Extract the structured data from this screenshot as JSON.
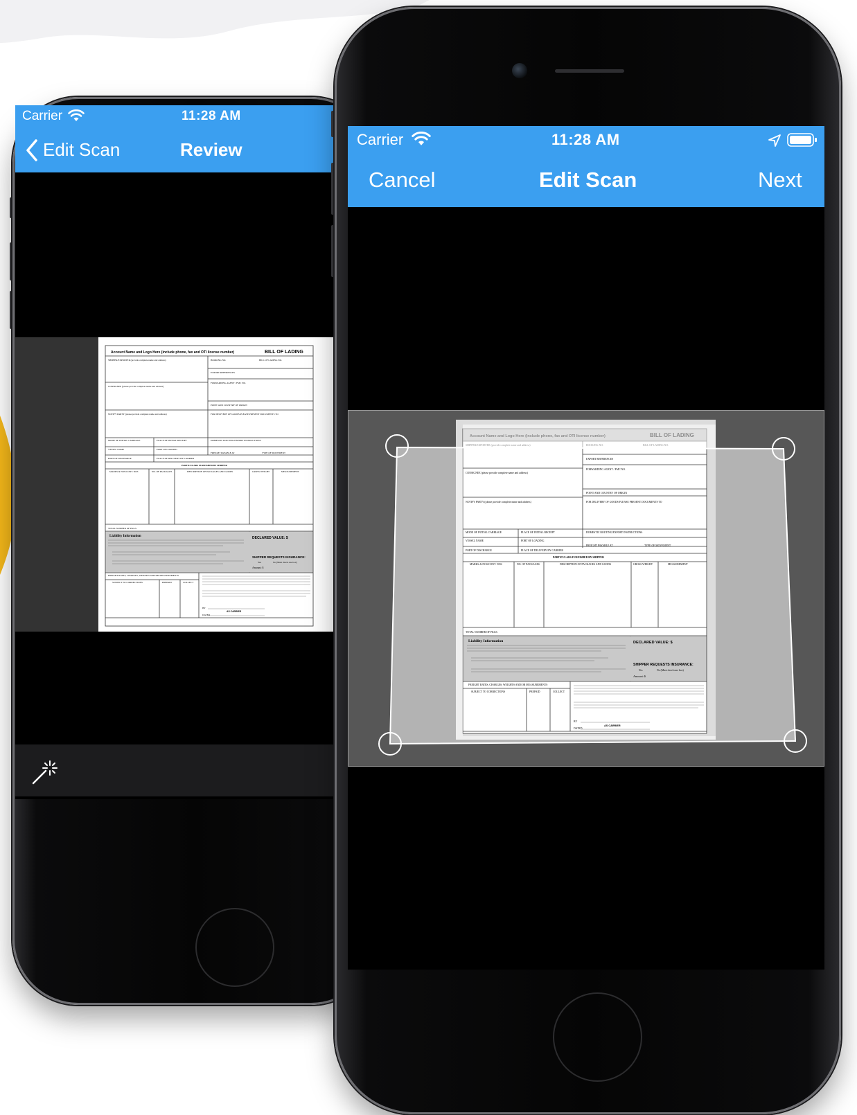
{
  "left_phone": {
    "status_bar": {
      "carrier": "Carrier",
      "time": "11:28 AM"
    },
    "nav_bar": {
      "back_label": "Edit Scan",
      "title": "Review"
    },
    "toolbar": {
      "icons": [
        "magic-wand-icon"
      ]
    }
  },
  "right_phone": {
    "status_bar": {
      "carrier": "Carrier",
      "time": "11:28 AM"
    },
    "nav_bar": {
      "cancel_label": "Cancel",
      "title": "Edit Scan",
      "next_label": "Next"
    }
  },
  "document": {
    "header_left": "Account Name and Logo Here (include phone, fax and OTI license number)",
    "header_right": "BILL OF LADING",
    "fields_left": [
      "SHIPPER/EXPORTER (provide complete name and address)",
      "CONSIGNEE (please provide complete name and address)",
      "NOTIFY PARTY (please provide complete name and address)"
    ],
    "fields_right": [
      "BOOKING NO.",
      "BILL OF LADING NO.",
      "EXPORT REFERENCES",
      "FORWARDING AGENT / FMC NO.",
      "POINT AND COUNTRY OF ORIGIN",
      "FOR DELIVERY OF GOODS PLEASE PRESENT DOCUMENTS TO"
    ],
    "transport_fields": [
      "MODE OF INITIAL CARRIAGE",
      "PLACE OF INITIAL RECEIPT",
      "DOMESTIC ROUTING/EXPORT INSTRUCTIONS",
      "VESSEL NAME",
      "PORT OF LOADING",
      "FREIGHT PAYABLE AT",
      "TYPE OF MOVEMENT",
      "PORT OF DISCHARGE",
      "PLACE OF DELIVERY BY CARRIER"
    ],
    "particulars_title": "PARTICULARS FURNISHED BY SHIPPER",
    "columns": [
      "MARKS & NOS/CONT. NOS",
      "NO. OF PACKAGES",
      "DESCRIPTION OF PACKAGES AND GOODS",
      "GROSS WEIGHT",
      "MEASUREMENT"
    ],
    "total_label": "TOTAL NUMBER OF PKGS.",
    "liability_title": "Liability Information",
    "declared_value": "DECLARED VALUE: $",
    "insurance_label": "SHIPPER REQUESTS INSURANCE:",
    "insurance_options": [
      "Yes",
      "No (Must check one box)"
    ],
    "amount_label": "Amount: $",
    "freight_label": "FREIGHT RATES, CHARGES, WEIGHTS AND/OR MEASUREMENTS",
    "charges_columns": [
      "SUBJECT TO CORRECTIONS",
      "PREPAID",
      "COLLECT"
    ],
    "signature_by": "BY",
    "as_carrier": "AS CARRIER",
    "dated": "DATED"
  }
}
